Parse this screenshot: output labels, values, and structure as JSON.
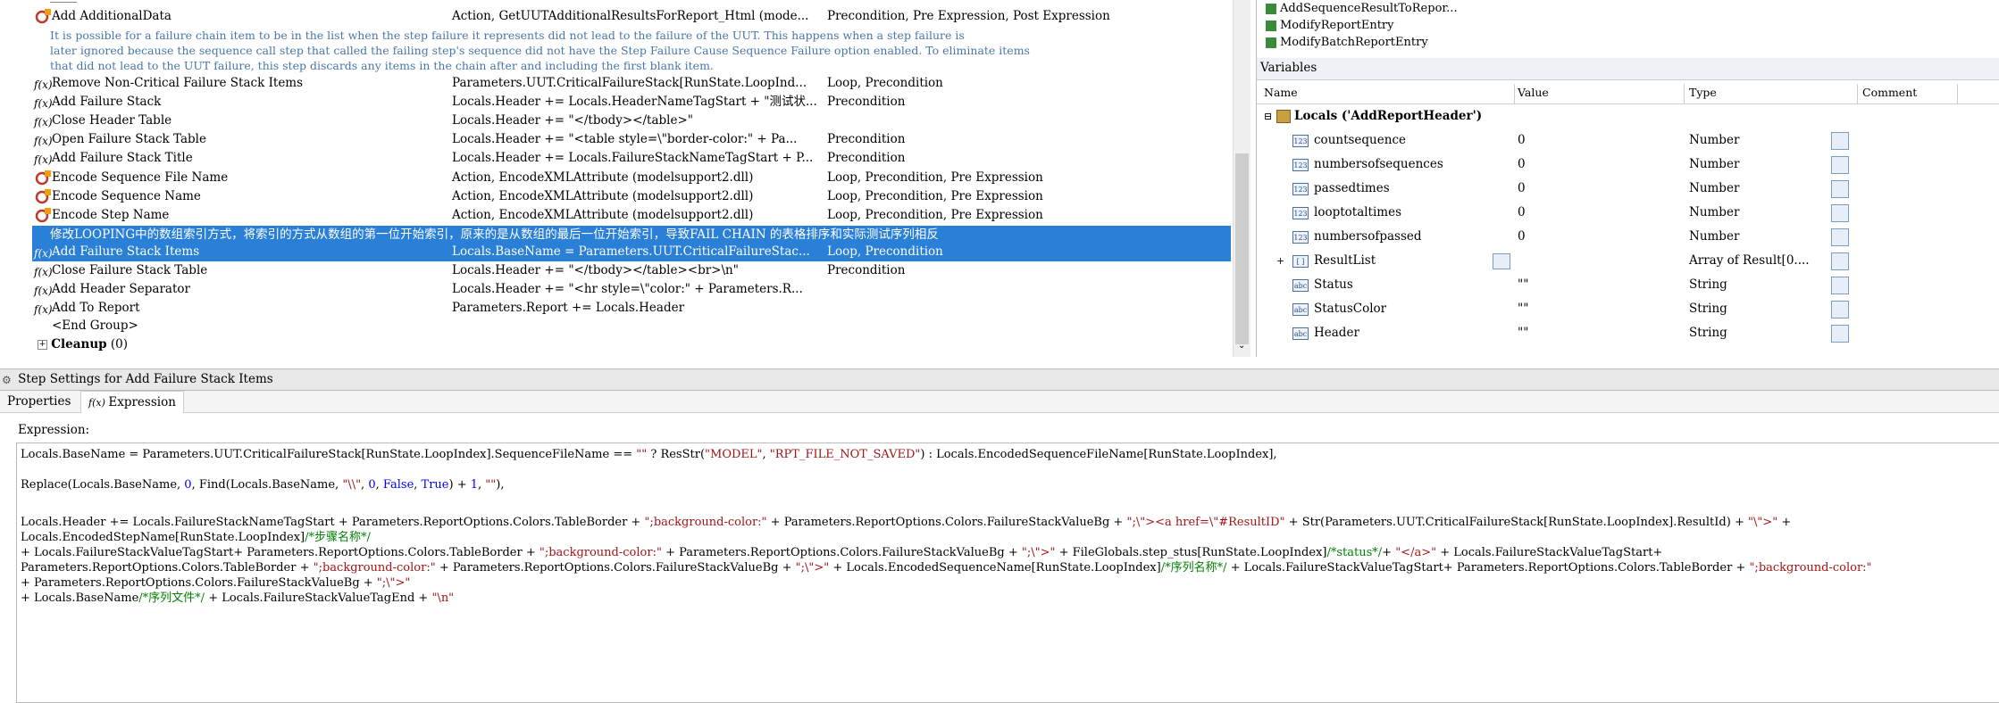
{
  "steps": {
    "rows": [
      {
        "icon": "action",
        "name": "Add AdditionalData",
        "desc": "Action,   GetUUTAdditionalResultsForReport_Html (mode...",
        "settings": "Precondition, Pre Expression, Post Expression"
      },
      {
        "icon": "fx",
        "name": "Remove Non-Critical Failure Stack Items",
        "desc": "Parameters.UUT.CriticalFailureStack[RunState.LoopInd...",
        "settings": "Loop, Precondition"
      },
      {
        "icon": "fx",
        "name": "Add Failure Stack",
        "desc": "Locals.Header += Locals.HeaderNameTagStart + \"测试状...",
        "settings": "Precondition"
      },
      {
        "icon": "fx",
        "name": "Close Header Table",
        "desc": "Locals.Header += \"</tbody></table>\"",
        "settings": ""
      },
      {
        "icon": "fx",
        "name": "Open Failure Stack Table",
        "desc": "Locals.Header += \"<table style=\\\"border-color:\" + Pa...",
        "settings": "Precondition"
      },
      {
        "icon": "fx",
        "name": "Add Failure Stack Title",
        "desc": "Locals.Header += Locals.FailureStackNameTagStart + P...",
        "settings": "Precondition"
      },
      {
        "icon": "action",
        "name": "Encode Sequence File Name",
        "desc": "Action,   EncodeXMLAttribute (modelsupport2.dll)",
        "settings": "Loop, Precondition, Pre Expression"
      },
      {
        "icon": "action",
        "name": "Encode Sequence Name",
        "desc": "Action,   EncodeXMLAttribute (modelsupport2.dll)",
        "settings": "Loop, Precondition, Pre Expression"
      },
      {
        "icon": "action",
        "name": "Encode Step Name",
        "desc": "Action,   EncodeXMLAttribute (modelsupport2.dll)",
        "settings": "Loop, Precondition, Pre Expression"
      },
      {
        "icon": "fx",
        "name": "Add Failure Stack Items",
        "desc": "Locals.BaseName = Parameters.UUT.CriticalFailureStac...",
        "settings": "Loop, Precondition"
      },
      {
        "icon": "fx",
        "name": "Close Failure Stack Table",
        "desc": "Locals.Header += \"</tbody></table><br>\\n\"",
        "settings": "Precondition"
      },
      {
        "icon": "fx",
        "name": "Add Header Separator",
        "desc": "Locals.Header += \"<hr style=\\\"color:\" + Parameters.R...",
        "settings": ""
      },
      {
        "icon": "fx",
        "name": "Add To Report",
        "desc": "Parameters.Report += Locals.Header",
        "settings": ""
      }
    ],
    "comment_lines": [
      "It is possible for a failure chain item to be in the list when the step failure it represents did not lead to the failure of the UUT. This happens when a step failure is",
      "later ignored because the sequence call step that called the failing step's sequence did not have the Step Failure Cause Sequence Failure option enabled.  To eliminate items",
      "that did not lead to the UUT failure, this step discards any items in the chain after and including the first blank item."
    ],
    "selected_comment": "修改LOOPING中的数组索引方式，将索引的方式从数组的第一位开始索引，原来的是从数组的最后一位开始索引，导致FAIL CHAIN 的表格排序和实际测试序列相反",
    "end_group": "<End Group>",
    "cleanup_label": "Cleanup",
    "cleanup_count": "(0)"
  },
  "variables": {
    "title": "Variables",
    "top_items": [
      "AddSequenceResultToRepor...",
      "ModifyReportEntry",
      "ModifyBatchReportEntry"
    ],
    "columns": [
      "Name",
      "Value",
      "Type",
      "Comment"
    ],
    "root": "Locals ('AddReportHeader')",
    "items": [
      {
        "icon": "num",
        "name": "countsequence",
        "value": "0",
        "type": "Number"
      },
      {
        "icon": "num",
        "name": "numbersofsequences",
        "value": "0",
        "type": "Number"
      },
      {
        "icon": "num",
        "name": "passedtimes",
        "value": "0",
        "type": "Number"
      },
      {
        "icon": "num",
        "name": "looptotaltimes",
        "value": "0",
        "type": "Number"
      },
      {
        "icon": "num",
        "name": "numbersofpassed",
        "value": "0",
        "type": "Number"
      },
      {
        "icon": "arr",
        "name": "ResultList",
        "value": "",
        "type": "Array of Result[0...."
      },
      {
        "icon": "str",
        "name": "Status",
        "value": "\"\"",
        "type": "String"
      },
      {
        "icon": "str",
        "name": "StatusColor",
        "value": "\"\"",
        "type": "String"
      },
      {
        "icon": "str",
        "name": "Header",
        "value": "\"\"",
        "type": "String"
      }
    ]
  },
  "settings": {
    "title": "Step Settings for Add Failure Stack Items",
    "tabs": [
      "Properties",
      "Expression"
    ],
    "expression_label": "Expression:"
  }
}
